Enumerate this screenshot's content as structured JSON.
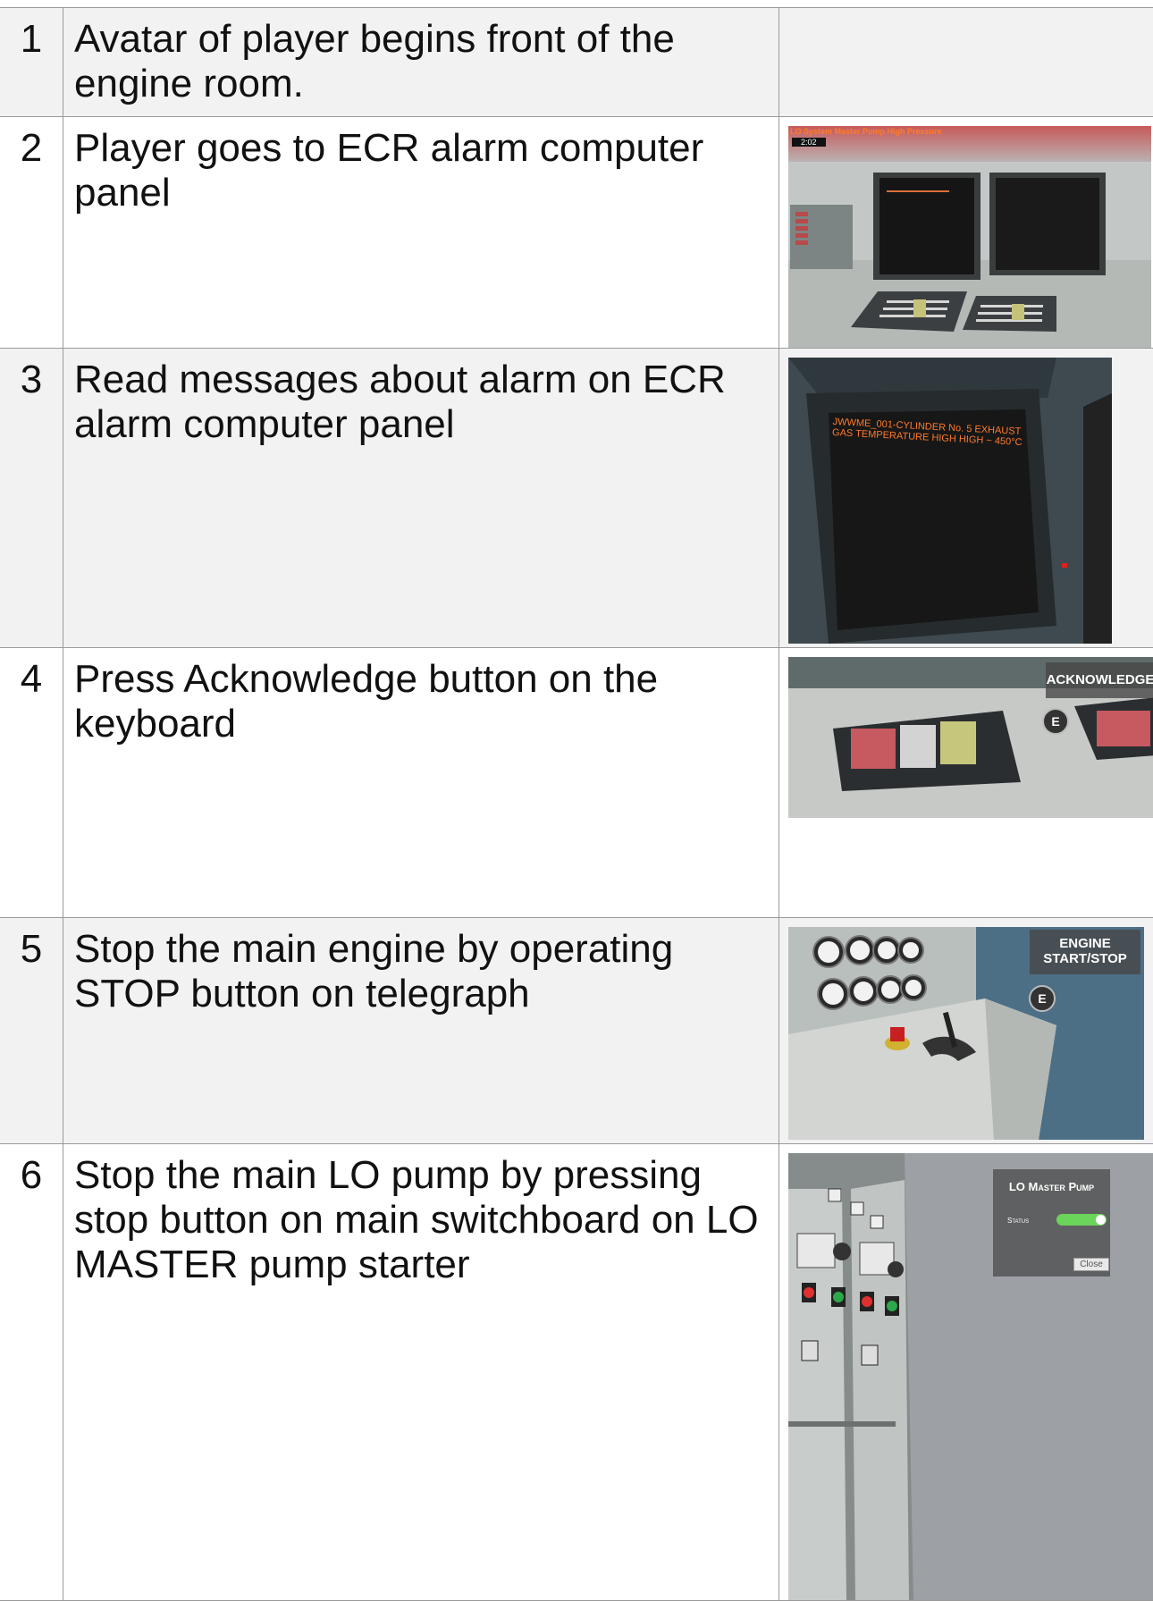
{
  "steps": [
    {
      "num": "1",
      "text": "Avatar of player begins front of the engine room."
    },
    {
      "num": "2",
      "text": "Player goes to ECR alarm computer panel"
    },
    {
      "num": "3",
      "text": "Read messages about alarm on ECR alarm computer panel"
    },
    {
      "num": "4",
      "text": "Press Acknowledge button on the keyboard"
    },
    {
      "num": "5",
      "text": "Stop the main engine by operating STOP button on telegraph"
    },
    {
      "num": "6",
      "text": "Stop the main LO pump by pressing stop button on main switchboard on LO MASTER pump starter"
    }
  ],
  "shot2": {
    "banner": "LO System Master Pump High Pressure",
    "timer": "2:02"
  },
  "shot3": {
    "alarm_line1": "JWWME_001-CYLINDER No. 5 EXHAUST",
    "alarm_line2": "GAS TEMPERATURE HIGH HIGH ~ 450°C"
  },
  "shot4": {
    "label": "ACKNOWLEDGE",
    "key": "E"
  },
  "shot5": {
    "label_line1": "ENGINE",
    "label_line2": "START/STOP",
    "key": "E"
  },
  "shot6": {
    "panel_title": "LO Master Pump",
    "status_label": "Status",
    "close_label": "Close"
  },
  "colors": {
    "accent_orange": "#ff7a2a",
    "toggle_green": "#6bd45a",
    "border": "#9a9a9a"
  }
}
